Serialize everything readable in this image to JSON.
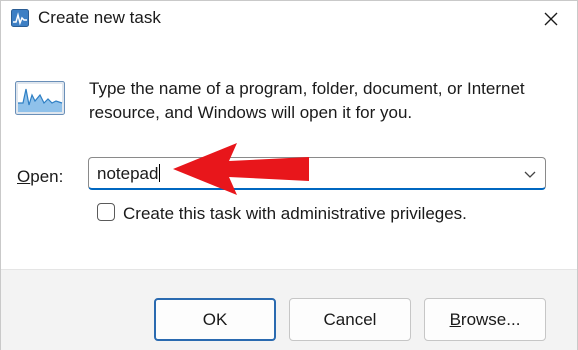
{
  "window": {
    "title": "Create new task"
  },
  "dialog": {
    "description": "Type the name of a program, folder, document, or Internet resource, and Windows will open it for you.",
    "open_label_prefix": "",
    "open_label_underlined": "O",
    "open_label_rest": "pen:",
    "open_value": "notepad",
    "admin_checkbox_label": "Create this task with administrative privileges.",
    "admin_checked": false
  },
  "buttons": {
    "ok": "OK",
    "cancel": "Cancel",
    "browse_underlined": "B",
    "browse_rest": "rowse..."
  },
  "icons": {
    "title": "task-manager-icon",
    "program": "activity-monitor-icon",
    "close": "close-icon",
    "dropdown": "chevron-down-icon",
    "annotation": "red-arrow"
  },
  "colors": {
    "accent": "#0067c0",
    "annotation_arrow": "#e8161b"
  }
}
